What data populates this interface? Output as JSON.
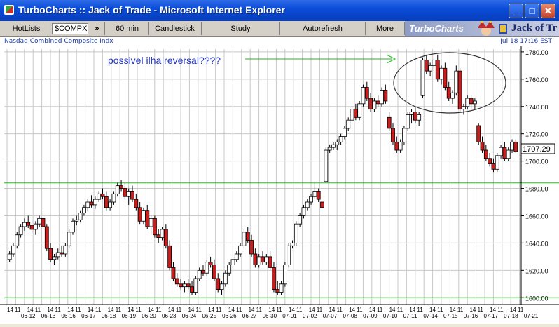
{
  "window": {
    "title": "TurboCharts :: Jack of Trade - Microsoft Internet Explorer",
    "minimize_glyph": "_",
    "maximize_glyph": "□",
    "close_glyph": "✕"
  },
  "toolbar": {
    "hotlists_label": "HotLists",
    "symbol_value": "$COMPX",
    "arrows_glyph": "»",
    "interval_label": "60 min",
    "style_label": "Candlestick",
    "study_label": "Study",
    "autorefresh_label": "Autorefresh",
    "more_label": "More"
  },
  "brand": {
    "name": "TurboCharts",
    "tagline": "Jack of Tr"
  },
  "info": {
    "index_name": "Nasdaq Combined Composite Indx",
    "timestamp": "Jul 18 17:16 EST"
  },
  "annotation": {
    "text": "possivel ilha reversal????"
  },
  "chart_data": {
    "type": "candlestick",
    "interval": "60 min",
    "ylim": [
      1595,
      1782
    ],
    "y_ticks": [
      1600,
      1620,
      1640,
      1660,
      1680,
      1700,
      1720,
      1740,
      1760,
      1780
    ],
    "last_price": "1707.29",
    "horizontal_lines": [
      1684,
      1600
    ],
    "hour_tick_label": "14 11",
    "date_labels": [
      "06-12",
      "06-13",
      "06-16",
      "06-17",
      "06-18",
      "06-19",
      "06-20",
      "06-23",
      "06-24",
      "06-25",
      "06-26",
      "06-27",
      "06-30",
      "07-01",
      "07-02",
      "07-07",
      "07-08",
      "07-09",
      "07-10",
      "07-11",
      "07-14",
      "07-15",
      "07-16",
      "07-17",
      "07-18",
      "07-21"
    ],
    "candles": [
      [
        1628,
        1634,
        1626,
        1632
      ],
      [
        1632,
        1640,
        1630,
        1638
      ],
      [
        1638,
        1648,
        1636,
        1646
      ],
      [
        1646,
        1654,
        1644,
        1652
      ],
      [
        1652,
        1658,
        1649,
        1655
      ],
      [
        1655,
        1660,
        1651,
        1653
      ],
      [
        1653,
        1657,
        1648,
        1650
      ],
      [
        1650,
        1656,
        1646,
        1654
      ],
      [
        1654,
        1660,
        1652,
        1658
      ],
      [
        1658,
        1662,
        1650,
        1652
      ],
      [
        1652,
        1654,
        1634,
        1636
      ],
      [
        1636,
        1640,
        1626,
        1628
      ],
      [
        1628,
        1632,
        1624,
        1630
      ],
      [
        1630,
        1636,
        1628,
        1633
      ],
      [
        1633,
        1638,
        1630,
        1632
      ],
      [
        1632,
        1640,
        1630,
        1638
      ],
      [
        1638,
        1650,
        1636,
        1648
      ],
      [
        1648,
        1658,
        1646,
        1656
      ],
      [
        1656,
        1660,
        1653,
        1657
      ],
      [
        1657,
        1664,
        1655,
        1662
      ],
      [
        1662,
        1668,
        1660,
        1666
      ],
      [
        1666,
        1672,
        1664,
        1670
      ],
      [
        1670,
        1675,
        1666,
        1668
      ],
      [
        1668,
        1674,
        1665,
        1672
      ],
      [
        1672,
        1678,
        1670,
        1676
      ],
      [
        1676,
        1680,
        1672,
        1674
      ],
      [
        1674,
        1678,
        1664,
        1666
      ],
      [
        1666,
        1672,
        1664,
        1670
      ],
      [
        1670,
        1678,
        1668,
        1676
      ],
      [
        1676,
        1684,
        1674,
        1682
      ],
      [
        1682,
        1686,
        1678,
        1680
      ],
      [
        1680,
        1684,
        1672,
        1674
      ],
      [
        1674,
        1680,
        1668,
        1678
      ],
      [
        1678,
        1682,
        1670,
        1672
      ],
      [
        1672,
        1676,
        1664,
        1666
      ],
      [
        1666,
        1670,
        1654,
        1656
      ],
      [
        1656,
        1666,
        1654,
        1664
      ],
      [
        1664,
        1668,
        1650,
        1652
      ],
      [
        1652,
        1660,
        1646,
        1658
      ],
      [
        1658,
        1660,
        1644,
        1646
      ],
      [
        1646,
        1650,
        1640,
        1644
      ],
      [
        1644,
        1652,
        1642,
        1650
      ],
      [
        1650,
        1654,
        1636,
        1638
      ],
      [
        1638,
        1642,
        1620,
        1622
      ],
      [
        1622,
        1626,
        1612,
        1614
      ],
      [
        1614,
        1618,
        1608,
        1610
      ],
      [
        1610,
        1614,
        1606,
        1608
      ],
      [
        1608,
        1612,
        1604,
        1610
      ],
      [
        1610,
        1614,
        1606,
        1608
      ],
      [
        1608,
        1612,
        1602,
        1604
      ],
      [
        1604,
        1616,
        1602,
        1614
      ],
      [
        1614,
        1622,
        1612,
        1620
      ],
      [
        1620,
        1624,
        1616,
        1618
      ],
      [
        1618,
        1628,
        1616,
        1626
      ],
      [
        1626,
        1630,
        1622,
        1624
      ],
      [
        1624,
        1628,
        1612,
        1614
      ],
      [
        1614,
        1618,
        1604,
        1606
      ],
      [
        1606,
        1612,
        1602,
        1610
      ],
      [
        1610,
        1620,
        1608,
        1618
      ],
      [
        1618,
        1626,
        1616,
        1624
      ],
      [
        1624,
        1630,
        1622,
        1628
      ],
      [
        1628,
        1634,
        1626,
        1632
      ],
      [
        1632,
        1640,
        1630,
        1638
      ],
      [
        1638,
        1650,
        1636,
        1648
      ],
      [
        1648,
        1652,
        1640,
        1642
      ],
      [
        1642,
        1646,
        1630,
        1632
      ],
      [
        1632,
        1636,
        1622,
        1624
      ],
      [
        1624,
        1632,
        1622,
        1630
      ],
      [
        1630,
        1634,
        1624,
        1626
      ],
      [
        1626,
        1632,
        1624,
        1630
      ],
      [
        1630,
        1634,
        1620,
        1622
      ],
      [
        1622,
        1626,
        1604,
        1606
      ],
      [
        1606,
        1612,
        1602,
        1604
      ],
      [
        1604,
        1612,
        1602,
        1610
      ],
      [
        1610,
        1626,
        1608,
        1624
      ],
      [
        1624,
        1640,
        1622,
        1638
      ],
      [
        1638,
        1642,
        1636,
        1640
      ],
      [
        1640,
        1656,
        1638,
        1654
      ],
      [
        1654,
        1662,
        1652,
        1660
      ],
      [
        1660,
        1668,
        1658,
        1666
      ],
      [
        1666,
        1672,
        1664,
        1670
      ],
      [
        1670,
        1676,
        1668,
        1674
      ],
      [
        1674,
        1684,
        1672,
        1678
      ],
      [
        1678,
        1680,
        1670,
        1672
      ],
      [
        1670,
        1668,
        1666,
        1666
      ],
      [
        1685,
        1710,
        1684,
        1708
      ],
      [
        1708,
        1712,
        1706,
        1710
      ],
      [
        1710,
        1714,
        1708,
        1712
      ],
      [
        1712,
        1716,
        1708,
        1714
      ],
      [
        1714,
        1720,
        1712,
        1718
      ],
      [
        1718,
        1726,
        1716,
        1724
      ],
      [
        1724,
        1732,
        1722,
        1730
      ],
      [
        1730,
        1740,
        1728,
        1738
      ],
      [
        1738,
        1742,
        1730,
        1732
      ],
      [
        1732,
        1744,
        1730,
        1742
      ],
      [
        1742,
        1756,
        1740,
        1754
      ],
      [
        1754,
        1758,
        1744,
        1746
      ],
      [
        1746,
        1750,
        1736,
        1738
      ],
      [
        1738,
        1746,
        1736,
        1744
      ],
      [
        1744,
        1748,
        1740,
        1742
      ],
      [
        1742,
        1754,
        1740,
        1752
      ],
      [
        1752,
        1756,
        1742,
        1744
      ],
      [
        1732,
        1736,
        1722,
        1724
      ],
      [
        1724,
        1728,
        1712,
        1714
      ],
      [
        1714,
        1718,
        1706,
        1708
      ],
      [
        1708,
        1716,
        1706,
        1714
      ],
      [
        1714,
        1726,
        1712,
        1724
      ],
      [
        1724,
        1736,
        1722,
        1734
      ],
      [
        1734,
        1738,
        1728,
        1736
      ],
      [
        1736,
        1740,
        1728,
        1730
      ],
      [
        1730,
        1736,
        1726,
        1734
      ],
      [
        1748,
        1776,
        1746,
        1774
      ],
      [
        1774,
        1778,
        1764,
        1766
      ],
      [
        1766,
        1772,
        1762,
        1770
      ],
      [
        1770,
        1776,
        1766,
        1774
      ],
      [
        1774,
        1778,
        1758,
        1760
      ],
      [
        1760,
        1770,
        1756,
        1768
      ],
      [
        1768,
        1772,
        1752,
        1754
      ],
      [
        1754,
        1758,
        1744,
        1746
      ],
      [
        1746,
        1752,
        1742,
        1750
      ],
      [
        1750,
        1770,
        1748,
        1766
      ],
      [
        1766,
        1768,
        1736,
        1738
      ],
      [
        1738,
        1742,
        1734,
        1740
      ],
      [
        1740,
        1748,
        1738,
        1746
      ],
      [
        1746,
        1748,
        1738,
        1742
      ],
      [
        1742,
        1746,
        1738,
        1744
      ],
      [
        1726,
        1728,
        1712,
        1714
      ],
      [
        1714,
        1718,
        1706,
        1708
      ],
      [
        1708,
        1712,
        1700,
        1702
      ],
      [
        1702,
        1706,
        1696,
        1698
      ],
      [
        1698,
        1702,
        1692,
        1694
      ],
      [
        1694,
        1706,
        1692,
        1704
      ],
      [
        1704,
        1712,
        1702,
        1710
      ],
      [
        1710,
        1714,
        1700,
        1702
      ],
      [
        1702,
        1710,
        1700,
        1708
      ],
      [
        1708,
        1716,
        1706,
        1714
      ],
      [
        1714,
        1716,
        1706,
        1707
      ]
    ]
  }
}
